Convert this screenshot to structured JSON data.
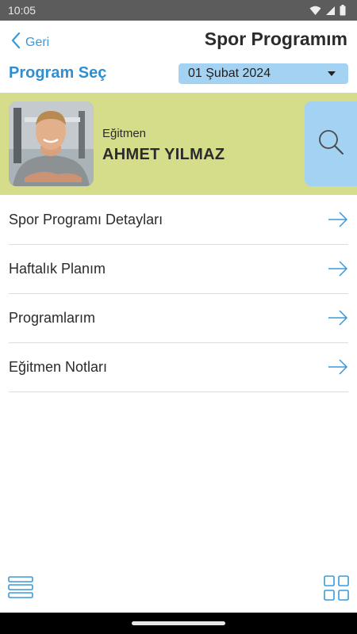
{
  "status_bar": {
    "time": "10:05",
    "icons": [
      "wifi-icon",
      "signal-icon",
      "battery-icon"
    ]
  },
  "header": {
    "back_label": "Geri",
    "title": "Spor Programım",
    "program_select_label": "Program Seç",
    "selected_date": "01 Şubat 2024"
  },
  "trainer": {
    "role": "Eğitmen",
    "name": "AHMET YILMAZ"
  },
  "menu": {
    "items": [
      {
        "label": "Spor Programı Detayları"
      },
      {
        "label": "Haftalık Planım"
      },
      {
        "label": "Programlarım"
      },
      {
        "label": "Eğitmen Notları"
      }
    ]
  },
  "colors": {
    "accent_blue": "#2f8fd1",
    "select_bg": "#a3d2f2",
    "trainer_card_bg": "#d5dd8a",
    "status_bar_bg": "#5c5c5c"
  },
  "bottom_bar": {
    "icons": [
      "list-menu-icon",
      "grid-icon"
    ]
  }
}
